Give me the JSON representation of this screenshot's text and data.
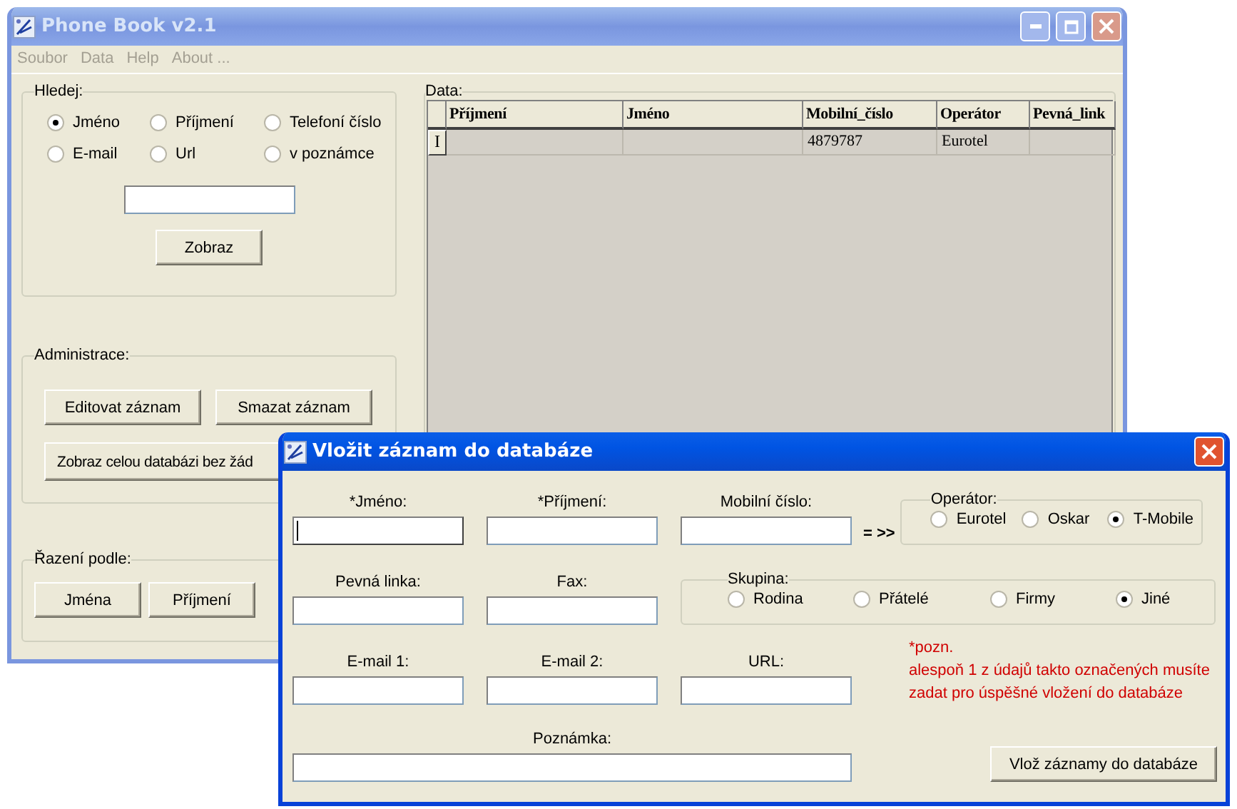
{
  "main_window": {
    "title": "Phone Book v2.1",
    "active": false,
    "menu": [
      "Soubor",
      "Data",
      "Help",
      "About ..."
    ],
    "search": {
      "title": "Hledej:",
      "options": [
        {
          "label": "Jméno",
          "selected": true
        },
        {
          "label": "Příjmení",
          "selected": false
        },
        {
          "label": "Telefoní číslo",
          "selected": false
        },
        {
          "label": "E-mail",
          "selected": false
        },
        {
          "label": "Url",
          "selected": false
        },
        {
          "label": "v poznámce",
          "selected": false
        }
      ],
      "button": "Zobraz"
    },
    "admin": {
      "title": "Administrace:",
      "buttons": [
        "Editovat záznam",
        "Smazat záznam",
        "Zobraz celou databázi bez žád"
      ]
    },
    "sort": {
      "title": "Řazení podle:",
      "buttons": [
        "Jména",
        "Příjmení"
      ]
    },
    "data": {
      "title": "Data:",
      "columns": [
        "Příjmení",
        "Jméno",
        "Mobilní_číslo",
        "Operátor",
        "Pevná_link"
      ],
      "rows": [
        {
          "marker": "I",
          "cells": [
            null,
            null,
            "4879787",
            "Eurotel",
            null
          ]
        }
      ]
    }
  },
  "dialog": {
    "title": "Vložit záznam do databáze",
    "active": true,
    "fields": [
      {
        "label": "*Jméno:",
        "focused": true
      },
      {
        "label": "*Příjmení:",
        "focused": false
      },
      {
        "label": "Mobilní číslo:",
        "focused": false
      },
      {
        "label": "Pevná linka:",
        "focused": false
      },
      {
        "label": "Fax:",
        "focused": false
      },
      {
        "label": "E-mail 1:",
        "focused": false
      },
      {
        "label": "E-mail 2:",
        "focused": false
      },
      {
        "label": "URL:",
        "focused": false
      }
    ],
    "arrow": "= >>",
    "operator": {
      "title": "Operátor:",
      "options": [
        {
          "label": "Eurotel",
          "selected": false
        },
        {
          "label": "Oskar",
          "selected": false
        },
        {
          "label": "T-Mobile",
          "selected": true
        }
      ]
    },
    "group": {
      "title": "Skupina:",
      "options": [
        {
          "label": "Rodina",
          "selected": false
        },
        {
          "label": "Přátelé",
          "selected": false
        },
        {
          "label": "Firmy",
          "selected": false
        },
        {
          "label": "Jiné",
          "selected": true
        }
      ]
    },
    "note": [
      "*pozn.",
      "alespoň 1 z údajů takto označených musíte",
      "zadat pro úspěšné vložení do databáze"
    ],
    "memo": {
      "label": "Poznámka:"
    },
    "submit": "Vlož záznamy do databáze"
  }
}
